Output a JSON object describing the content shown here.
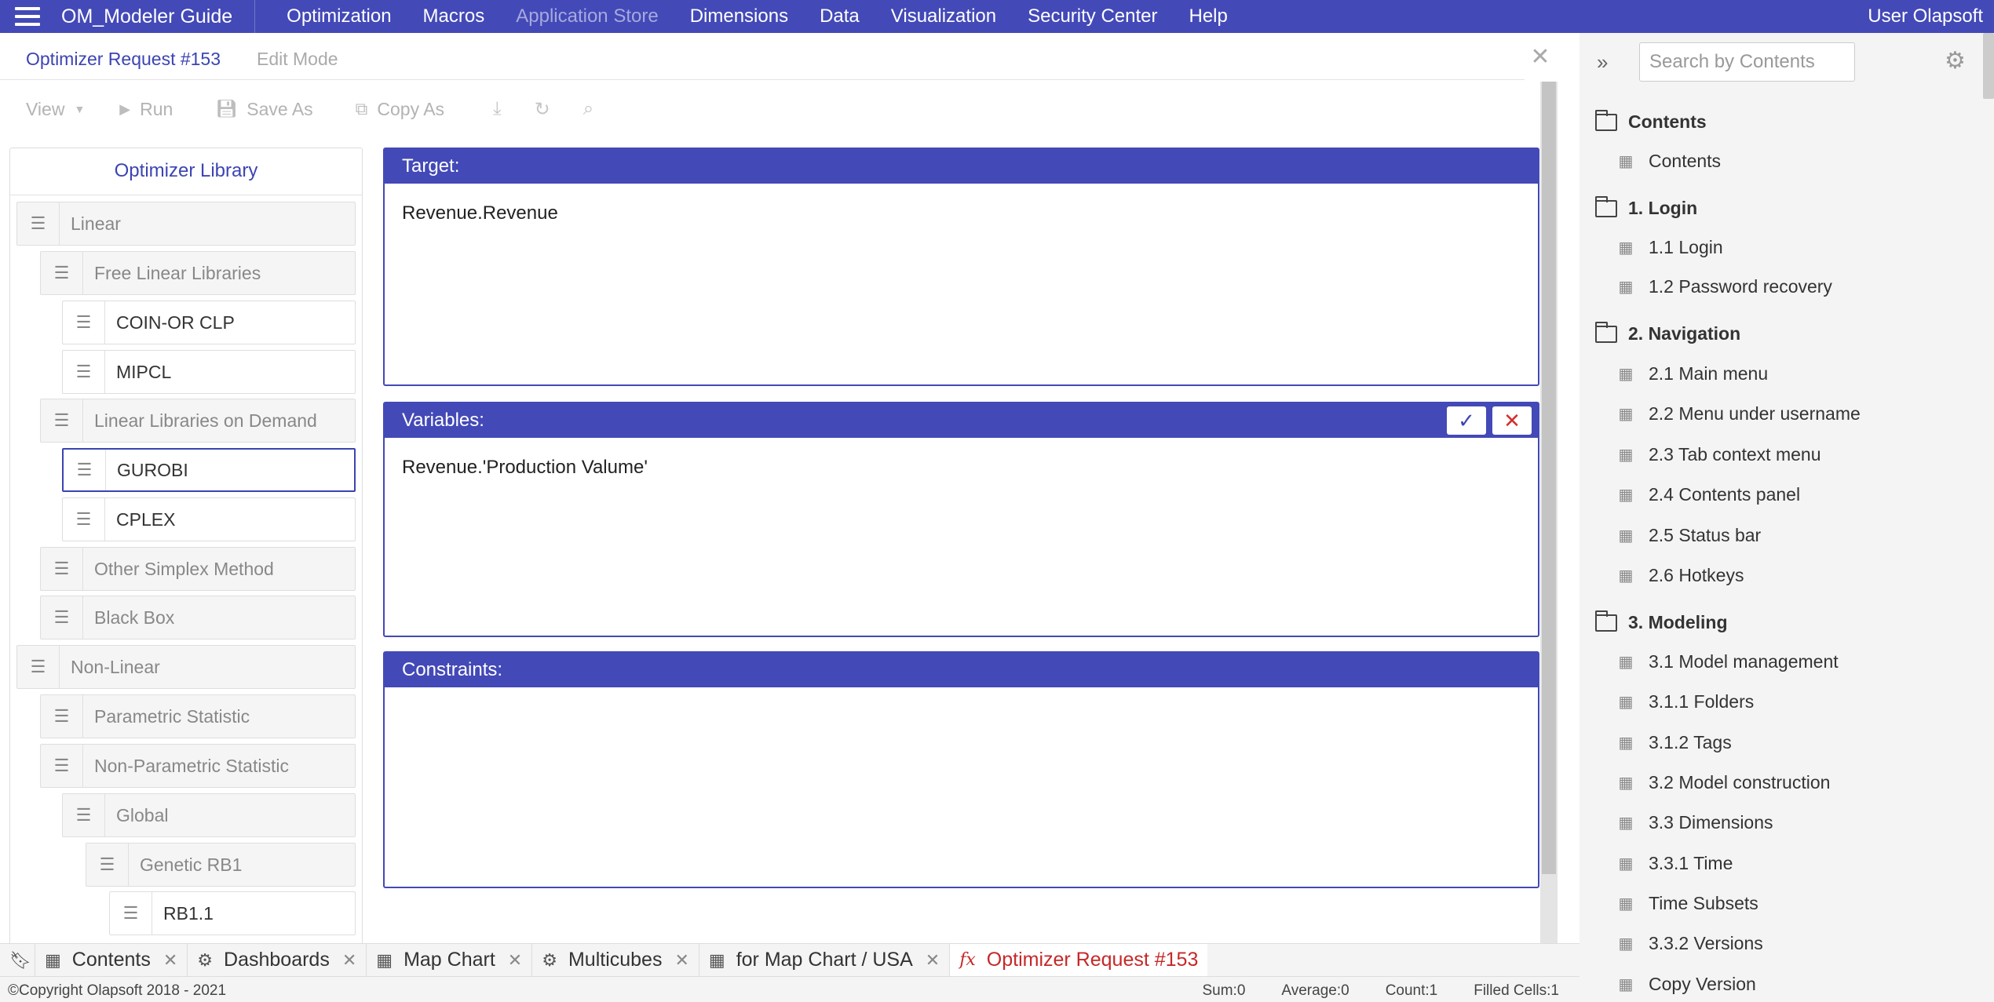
{
  "app": {
    "title": "OM_Modeler Guide"
  },
  "nav": {
    "items": [
      {
        "label": "Optimization"
      },
      {
        "label": "Macros"
      },
      {
        "label": "Application Store"
      },
      {
        "label": "Dimensions"
      },
      {
        "label": "Data"
      },
      {
        "label": "Visualization"
      },
      {
        "label": "Security Center"
      },
      {
        "label": "Help"
      }
    ],
    "user": "User Olapsoft"
  },
  "request": {
    "title": "Optimizer Request #153",
    "mode": "Edit Mode"
  },
  "toolbar": {
    "view": "View",
    "run": "Run",
    "save_as": "Save As",
    "copy_as": "Copy As"
  },
  "library": {
    "title": "Optimizer Library",
    "items": [
      {
        "label": "Linear"
      },
      {
        "label": "Free Linear Libraries"
      },
      {
        "label": "COIN-OR CLP"
      },
      {
        "label": "MIPCL"
      },
      {
        "label": "Linear Libraries on Demand"
      },
      {
        "label": "GUROBI"
      },
      {
        "label": "CPLEX"
      },
      {
        "label": "Other Simplex Method"
      },
      {
        "label": "Black Box"
      },
      {
        "label": "Non-Linear"
      },
      {
        "label": "Parametric Statistic"
      },
      {
        "label": "Non-Parametric Statistic"
      },
      {
        "label": "Global"
      },
      {
        "label": "Genetic RB1"
      },
      {
        "label": "RB1.1"
      }
    ]
  },
  "panels": {
    "target": {
      "label": "Target:",
      "value": "Revenue.Revenue"
    },
    "variables": {
      "label": "Variables:",
      "value": "Revenue.'Production Valume'"
    },
    "constraints": {
      "label": "Constraints:",
      "value": ""
    }
  },
  "contents": {
    "search_placeholder": "Search by Contents",
    "folders": [
      {
        "label": "Contents"
      },
      {
        "label": "1. Login"
      },
      {
        "label": "2. Navigation"
      },
      {
        "label": "3. Modeling"
      }
    ],
    "items": [
      {
        "label": "Contents"
      },
      {
        "label": "1.1 Login"
      },
      {
        "label": "1.2 Password recovery"
      },
      {
        "label": "2.1 Main menu"
      },
      {
        "label": "2.2 Menu under username"
      },
      {
        "label": "2.3 Tab context menu"
      },
      {
        "label": "2.4 Contents panel"
      },
      {
        "label": "2.5 Status bar"
      },
      {
        "label": "2.6 Hotkeys"
      },
      {
        "label": "3.1 Model management"
      },
      {
        "label": "3.1.1 Folders"
      },
      {
        "label": "3.1.2 Tags"
      },
      {
        "label": "3.2 Model construction"
      },
      {
        "label": "3.3 Dimensions"
      },
      {
        "label": "3.3.1 Time"
      },
      {
        "label": "Time Subsets"
      },
      {
        "label": "3.3.2 Versions"
      },
      {
        "label": "Copy Version"
      }
    ]
  },
  "tabs": [
    {
      "label": "Contents"
    },
    {
      "label": "Dashboards"
    },
    {
      "label": "Map Chart"
    },
    {
      "label": "Multicubes"
    },
    {
      "label": "for Map Chart / USA"
    },
    {
      "label": "Optimizer Request #153"
    }
  ],
  "status": {
    "copyright": "©Copyright Olapsoft 2018 - 2021",
    "sum": "Sum:0",
    "average": "Average:0",
    "count": "Count:1",
    "filled": "Filled Cells:1"
  },
  "colors": {
    "accent": "#4349b7",
    "active_tab": "#c62828",
    "cancel": "#d32f2f"
  }
}
